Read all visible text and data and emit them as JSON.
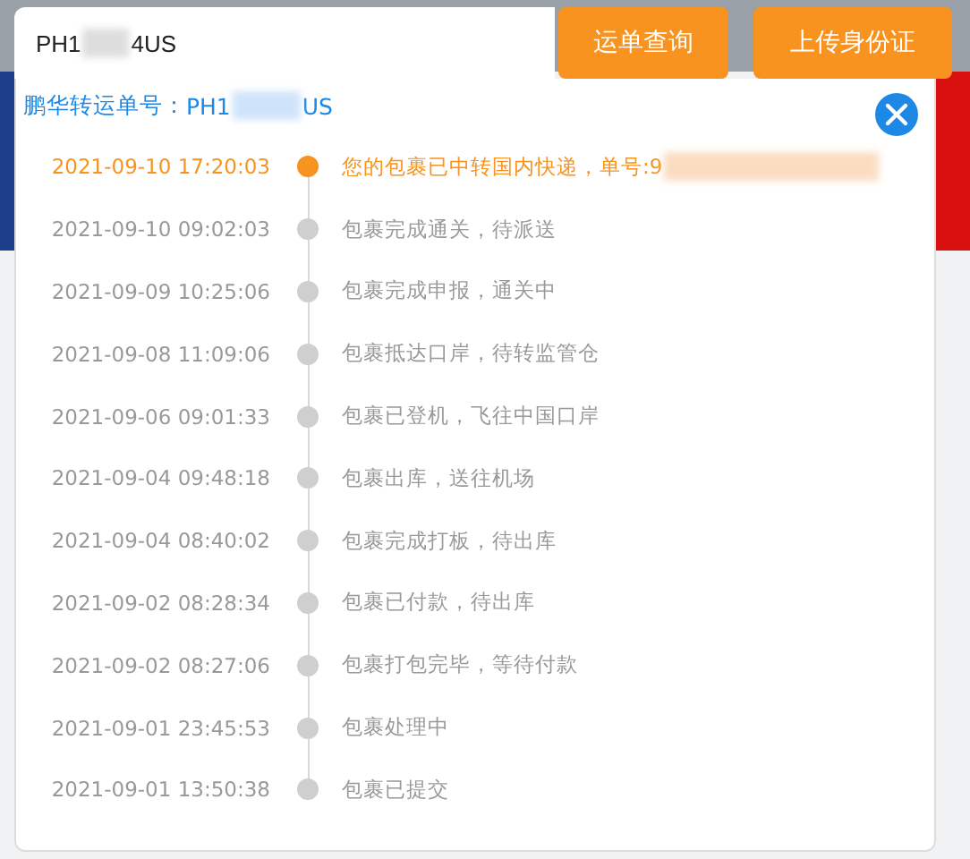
{
  "search": {
    "value_start": "PH1",
    "value_end": "4US",
    "redacted": true
  },
  "buttons": [
    "运单查询",
    "上传身份证"
  ],
  "transfer_number": {
    "label": "鹏华转运单号：",
    "value_start": "PH1",
    "value_end": "US",
    "redacted": true
  },
  "timeline": [
    {
      "time": "2021-09-10 17:20:03",
      "text": "您的包裹已中转国内快递，单号:9",
      "current": true,
      "redacted": true
    },
    {
      "time": "2021-09-10 09:02:03",
      "text": "包裹完成通关，待派送",
      "current": false,
      "redacted": false
    },
    {
      "time": "2021-09-09 10:25:06",
      "text": "包裹完成申报，通关中",
      "current": false,
      "redacted": false
    },
    {
      "time": "2021-09-08 11:09:06",
      "text": "包裹抵达口岸，待转监管仓",
      "current": false,
      "redacted": false
    },
    {
      "time": "2021-09-06 09:01:33",
      "text": "包裹已登机，飞往中国口岸",
      "current": false,
      "redacted": false
    },
    {
      "time": "2021-09-04 09:48:18",
      "text": "包裹出库，送往机场",
      "current": false,
      "redacted": false
    },
    {
      "time": "2021-09-04 08:40:02",
      "text": "包裹完成打板，待出库",
      "current": false,
      "redacted": false
    },
    {
      "time": "2021-09-02 08:28:34",
      "text": "包裹已付款，待出库",
      "current": false,
      "redacted": false
    },
    {
      "time": "2021-09-02 08:27:06",
      "text": "包裹打包完毕，等待付款",
      "current": false,
      "redacted": false
    },
    {
      "time": "2021-09-01 23:45:53",
      "text": "包裹处理中",
      "current": false,
      "redacted": false
    },
    {
      "time": "2021-09-01 13:50:38",
      "text": "包裹已提交",
      "current": false,
      "redacted": false
    }
  ]
}
